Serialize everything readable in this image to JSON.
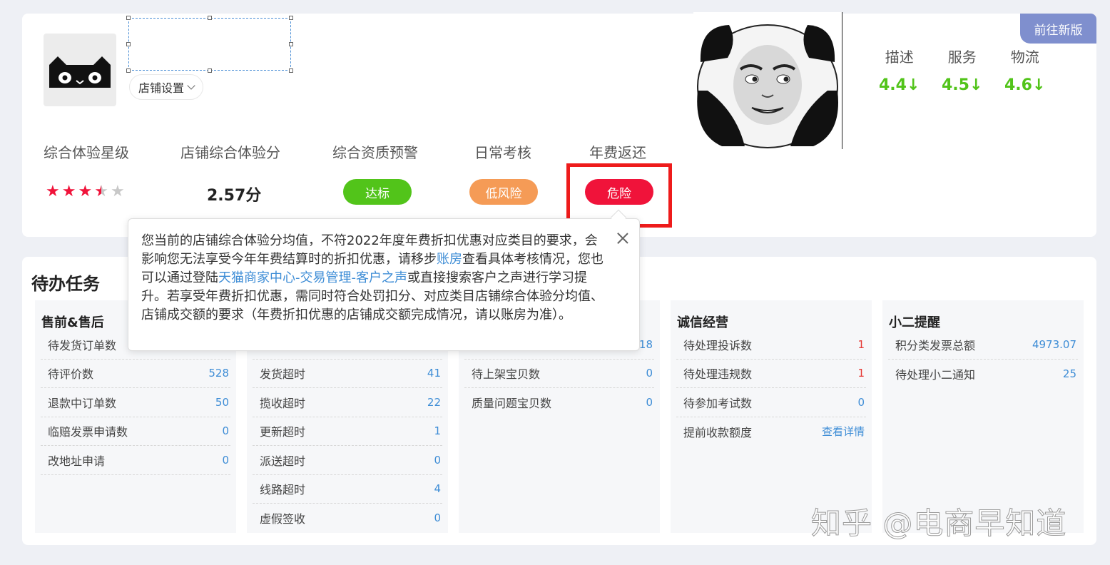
{
  "shop": {
    "settings_label": "店铺设置",
    "new_version_label": "前往新版"
  },
  "metrics": {
    "labels": [
      "综合体验星级",
      "店铺综合体验分",
      "综合资质预警",
      "日常考核",
      "年费返还"
    ],
    "star_rating": 3.5,
    "star_max": 5,
    "score": "2.57分",
    "qualification_status": "达标",
    "daily_check_status": "低风险",
    "annual_fee_status": "危险",
    "colors": {
      "ok": "#52c41a",
      "low_risk": "#f59b56",
      "danger": "#f0133a"
    }
  },
  "ratings": [
    {
      "label": "描述",
      "value": "4.4↓"
    },
    {
      "label": "服务",
      "value": "4.5↓"
    },
    {
      "label": "物流",
      "value": "4.6↓"
    }
  ],
  "tooltip": {
    "text_1": "您当前的店铺综合体验分均值，不符2022年度年费折扣优惠对应类目的要求，会影响您无法享受今年年费结算时的折扣优惠，请移步",
    "link_1": "账房",
    "text_2": "查看具体考核情况，您也可以通过登陆",
    "link_2": "天猫商家中心-交易管理-客户之声",
    "text_3": "或直接搜索客户之声进行学习提升。若享受年费折扣优惠，需同时符合处罚扣分、对应类目店铺综合体验分均值、店铺成交额的要求（年费折扣优惠的店铺成交额完成情况，请以账房为准）。"
  },
  "todo": {
    "title": "待办任务",
    "panels": [
      {
        "title": "售前&售后",
        "rows": [
          {
            "label": "待发货订单数",
            "value": ""
          },
          {
            "label": "待评价数",
            "value": "528"
          },
          {
            "label": "退款中订单数",
            "value": "50"
          },
          {
            "label": "临赔发票申请数",
            "value": "0"
          },
          {
            "label": "改地址申请",
            "value": "0"
          }
        ]
      },
      {
        "title": "",
        "rows": [
          {
            "label": "",
            "value": ""
          },
          {
            "label": "发货超时",
            "value": "41"
          },
          {
            "label": "揽收超时",
            "value": "22"
          },
          {
            "label": "更新超时",
            "value": "1"
          },
          {
            "label": "派送超时",
            "value": "0"
          },
          {
            "label": "线路超时",
            "value": "4"
          },
          {
            "label": "虚假签收",
            "value": "0"
          }
        ]
      },
      {
        "title": "",
        "rows": [
          {
            "label": "",
            "value": "18"
          },
          {
            "label": "待上架宝贝数",
            "value": "0"
          },
          {
            "label": "质量问题宝贝数",
            "value": "0"
          }
        ]
      },
      {
        "title": "诚信经营",
        "rows": [
          {
            "label": "待处理投诉数",
            "value": "1"
          },
          {
            "label": "待处理违规数",
            "value": "1"
          },
          {
            "label": "待参加考试数",
            "value": "0"
          },
          {
            "label": "提前收款额度",
            "value": "查看详情"
          }
        ]
      },
      {
        "title": "小二提醒",
        "rows": [
          {
            "label": "积分类发票总额",
            "value": "4973.07"
          },
          {
            "label": "待处理小二通知",
            "value": "25"
          }
        ]
      }
    ]
  },
  "watermark": "知乎 @电商早知道"
}
